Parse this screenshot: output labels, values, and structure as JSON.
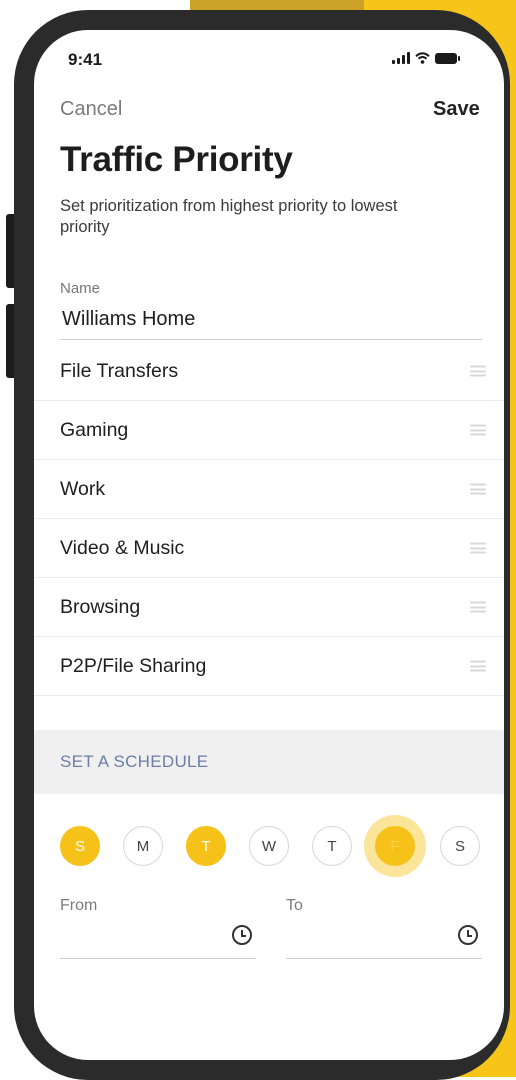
{
  "status_bar": {
    "time": "9:41"
  },
  "header": {
    "cancel_label": "Cancel",
    "save_label": "Save"
  },
  "page": {
    "title": "Traffic Priority",
    "subtitle": "Set prioritization from highest priority to lowest priority"
  },
  "name_field": {
    "label": "Name",
    "value": "Williams Home"
  },
  "priority_list": [
    {
      "label": "File Transfers"
    },
    {
      "label": "Gaming"
    },
    {
      "label": "Work"
    },
    {
      "label": "Video & Music"
    },
    {
      "label": "Browsing"
    },
    {
      "label": "P2P/File Sharing"
    }
  ],
  "schedule": {
    "section_label": "SET A SCHEDULE",
    "days": [
      {
        "label": "S",
        "selected": true
      },
      {
        "label": "M",
        "selected": false
      },
      {
        "label": "T",
        "selected": true
      },
      {
        "label": "W",
        "selected": false
      },
      {
        "label": "T",
        "selected": false
      },
      {
        "label": "F",
        "selected": true
      },
      {
        "label": "S",
        "selected": false
      }
    ],
    "from_label": "From",
    "to_label": "To"
  },
  "colors": {
    "accent": "#f6c21a",
    "background_accent": "#f7c51a",
    "section_label": "#6a7ea6"
  }
}
